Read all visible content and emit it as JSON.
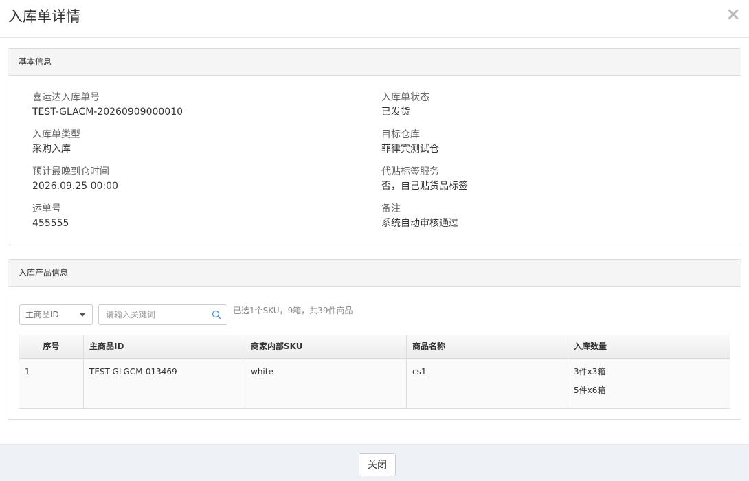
{
  "modal": {
    "title": "入库单详情",
    "close_symbol": "×"
  },
  "basic_info": {
    "heading": "基本信息",
    "left": [
      {
        "label": "喜运达入库单号",
        "value": "TEST-GLACM-20260909000010"
      },
      {
        "label": "入库单类型",
        "value": "采购入库"
      },
      {
        "label": "预计最晚到仓时间",
        "value": "2026.09.25 00:00"
      },
      {
        "label": "运单号",
        "value": "455555"
      }
    ],
    "right": [
      {
        "label": "入库单状态",
        "value": "已发货"
      },
      {
        "label": "目标仓库",
        "value": "菲律宾测试仓"
      },
      {
        "label": "代贴标签服务",
        "value": "否，自己贴货品标签"
      },
      {
        "label": "备注",
        "value": "系统自动审核通过"
      }
    ]
  },
  "products": {
    "heading": "入库产品信息",
    "filter_select": "主商品ID",
    "search_placeholder": "请输入关键词",
    "search_icon": "search-icon",
    "summary": "已选1个SKU，9箱，共39件商品",
    "columns": [
      "序号",
      "主商品ID",
      "商家内部SKU",
      "商品名称",
      "入库数量"
    ],
    "rows": [
      {
        "index": "1",
        "product_id": "TEST-GLGCM-013469",
        "sku": "white",
        "name": "cs1",
        "quantities": [
          "3件x3箱",
          "5件x6箱"
        ]
      }
    ]
  },
  "footer": {
    "close_label": "关闭"
  },
  "colors": {
    "panel_heading_bg": "#f5f5f5",
    "footer_bg": "#eef1f6",
    "search_icon": "#3a8ee6"
  }
}
